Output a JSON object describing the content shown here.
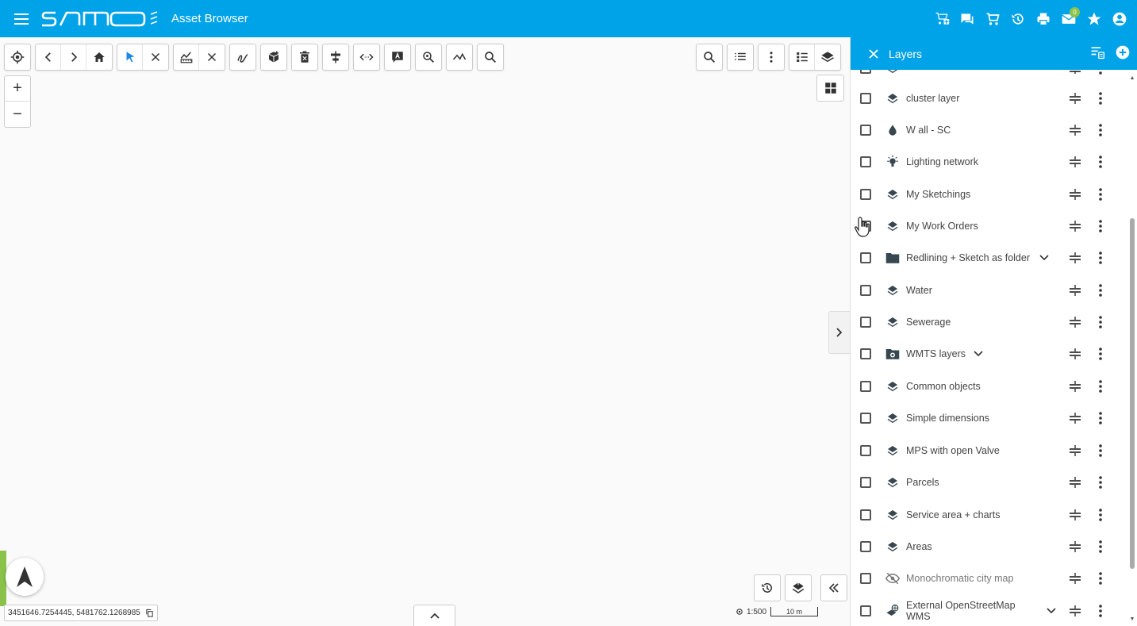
{
  "app": {
    "title": "Asset Browser",
    "brand_color": "#00a3e8",
    "accent_green": "#8bc34a",
    "mail_badge_count": "0"
  },
  "toolbar": {
    "left_icons": [
      "locate-icon",
      "back-icon",
      "forward-icon",
      "home-icon",
      "select-arrow-icon",
      "clear-selection-icon",
      "measure-icon",
      "clear-measure-icon",
      "sketch-icon",
      "3d-box-icon",
      "delete-icon",
      "align-icon",
      "code-icon",
      "label-icon",
      "zoom-search-icon",
      "line-tool-icon",
      "search-icon"
    ],
    "right_icons": [
      "search-icon",
      "list-icon",
      "more-vert-icon",
      "legend-icon",
      "layers-icon"
    ]
  },
  "map": {
    "coordinates": "3451646.7254445, 5481762.1268985",
    "scale_ratio": "1:500",
    "scale_bar_label": "10 m"
  },
  "layers_panel": {
    "title": "Layers",
    "items": [
      {
        "label": "cluster layer",
        "icon": "layer-stack-icon"
      },
      {
        "label": "W all - SC",
        "icon": "water-drop-icon"
      },
      {
        "label": "Lighting network",
        "icon": "light-bulb-icon"
      },
      {
        "label": "My Sketchings",
        "icon": "layer-stack-icon"
      },
      {
        "label": "My Work Orders",
        "icon": "layer-stack-icon"
      },
      {
        "label": "Redlining + Sketch as folder",
        "icon": "folder-icon",
        "expandable": true
      },
      {
        "label": "Water",
        "icon": "layer-stack-icon"
      },
      {
        "label": "Sewerage",
        "icon": "layer-stack-icon"
      },
      {
        "label": "WMTS layers",
        "icon": "wmts-folder-icon",
        "expandable": true
      },
      {
        "label": "Common objects",
        "icon": "layer-stack-icon"
      },
      {
        "label": "Simple dimensions",
        "icon": "layer-stack-icon"
      },
      {
        "label": "MPS with open Valve",
        "icon": "layer-stack-icon"
      },
      {
        "label": "Parcels",
        "icon": "layer-stack-icon"
      },
      {
        "label": "Service area + charts",
        "icon": "layer-stack-icon"
      },
      {
        "label": "Areas",
        "icon": "layer-stack-icon"
      },
      {
        "label": "Monochromatic city map",
        "icon": "eye-off-icon",
        "muted": true
      },
      {
        "label_line1": "External OpenStreetMap",
        "label_line2": "WMS",
        "icon": "globe-layer-icon",
        "expandable": true
      }
    ]
  }
}
